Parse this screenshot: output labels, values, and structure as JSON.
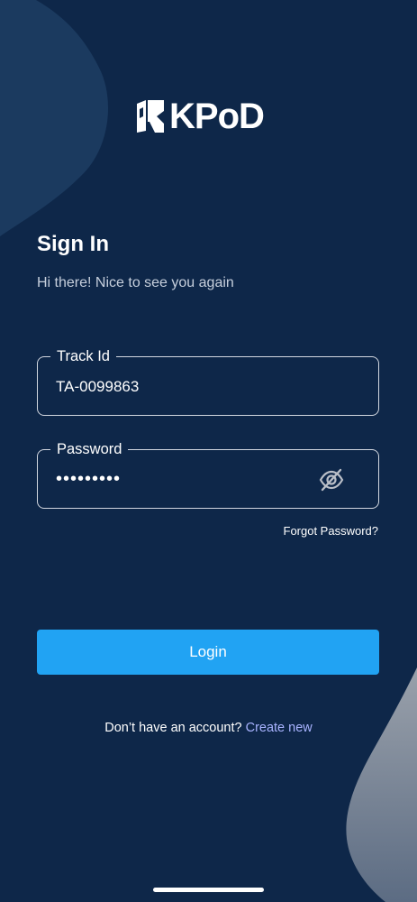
{
  "brand": {
    "logo_text": "KPoD"
  },
  "signin": {
    "title": "Sign In",
    "subtitle": "Hi there! Nice to see you again"
  },
  "fields": {
    "track_id": {
      "label": "Track Id",
      "value": "TA-0099863"
    },
    "password": {
      "label": "Password",
      "value": "•••••••••"
    }
  },
  "links": {
    "forgot_password": "Forgot Password?",
    "no_account": "Don’t have an account?",
    "create_new": "Create new"
  },
  "buttons": {
    "login": "Login"
  },
  "icons": {
    "eye": "eye-off-icon",
    "logo": "kpod-logo-mark-icon"
  },
  "colors": {
    "background": "#0e2749",
    "accent": "#21a3f3",
    "link": "#a8b3ff"
  }
}
